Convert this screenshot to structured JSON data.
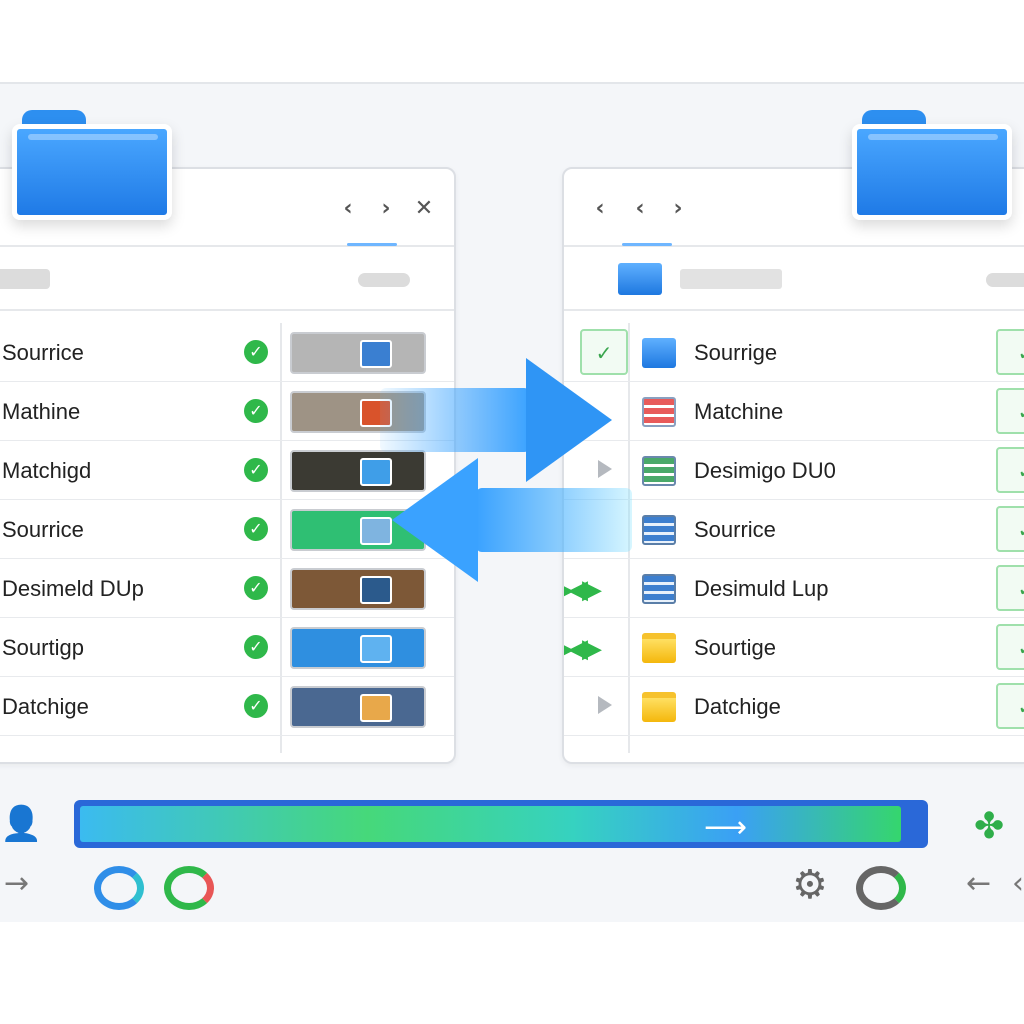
{
  "left_panel": {
    "window_controls": [
      "‹",
      "›",
      "✕"
    ],
    "rows": [
      {
        "label": "Sourrice",
        "status": "synced",
        "thumb_color": "#b5b5b5",
        "thumb_accent": "#3a7fd1"
      },
      {
        "label": "Mathine",
        "status": "synced",
        "thumb_color": "#9e9385",
        "thumb_accent": "#d9532b"
      },
      {
        "label": "Matchigd",
        "status": "synced",
        "thumb_color": "#3b3a33",
        "thumb_accent": "#3f9ee8"
      },
      {
        "label": "Sourrice",
        "status": "synced",
        "thumb_color": "#2fbf73",
        "thumb_accent": "#7fb4e0"
      },
      {
        "label": "Desimeld DUp",
        "status": "synced",
        "thumb_color": "#7d5837",
        "thumb_accent": "#2b5a8c"
      },
      {
        "label": "Sourtigp",
        "status": "synced",
        "thumb_color": "#2f8fe0",
        "thumb_accent": "#5fb2f0"
      },
      {
        "label": "Datchige",
        "status": "synced",
        "thumb_color": "#4a6891",
        "thumb_accent": "#e8a84a"
      }
    ]
  },
  "right_panel": {
    "window_controls": [
      "‹",
      "‹",
      "›"
    ],
    "rows": [
      {
        "label": "Sourrige",
        "icon": "shield-folder-icon",
        "marker": "checkbox"
      },
      {
        "label": "Matchine",
        "icon": "document-icon",
        "marker": "none"
      },
      {
        "label": "Desimigo DU0",
        "icon": "document-icon",
        "marker": "expand"
      },
      {
        "label": "Sourrice",
        "icon": "document-icon",
        "marker": "none"
      },
      {
        "label": "Desimuld Lup",
        "icon": "document-icon",
        "marker": "sync"
      },
      {
        "label": "Sourtige",
        "icon": "folder-icon",
        "marker": "sync"
      },
      {
        "label": "Datchige",
        "icon": "folder-icon",
        "marker": "expand"
      }
    ]
  },
  "transfer": {
    "progress_fraction": 0.98
  },
  "colors": {
    "accent_blue": "#1f7ae6",
    "success_green": "#2fb84a",
    "progress_track": "#2a68d8"
  }
}
